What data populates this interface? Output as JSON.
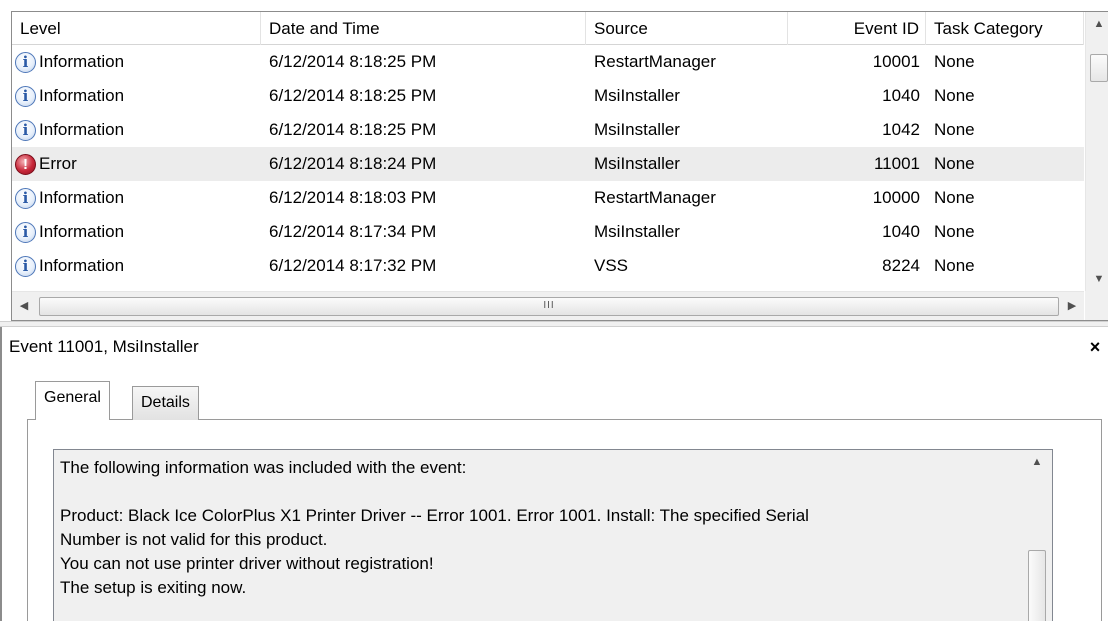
{
  "event_list": {
    "columns": {
      "level": "Level",
      "date_time": "Date and Time",
      "source": "Source",
      "event_id": "Event ID",
      "task_category": "Task Category"
    },
    "rows": [
      {
        "level": "Information",
        "level_icon": "information-icon",
        "date_time": "6/12/2014 8:18:25 PM",
        "source": "RestartManager",
        "event_id": "10001",
        "task_category": "None"
      },
      {
        "level": "Information",
        "level_icon": "information-icon",
        "date_time": "6/12/2014 8:18:25 PM",
        "source": "MsiInstaller",
        "event_id": "1040",
        "task_category": "None"
      },
      {
        "level": "Information",
        "level_icon": "information-icon",
        "date_time": "6/12/2014 8:18:25 PM",
        "source": "MsiInstaller",
        "event_id": "1042",
        "task_category": "None"
      },
      {
        "level": "Error",
        "level_icon": "error-icon",
        "date_time": "6/12/2014 8:18:24 PM",
        "source": "MsiInstaller",
        "event_id": "11001",
        "task_category": "None",
        "selected": true
      },
      {
        "level": "Information",
        "level_icon": "information-icon",
        "date_time": "6/12/2014 8:18:03 PM",
        "source": "RestartManager",
        "event_id": "10000",
        "task_category": "None"
      },
      {
        "level": "Information",
        "level_icon": "information-icon",
        "date_time": "6/12/2014 8:17:34 PM",
        "source": "MsiInstaller",
        "event_id": "1040",
        "task_category": "None"
      },
      {
        "level": "Information",
        "level_icon": "information-icon",
        "date_time": "6/12/2014 8:17:32 PM",
        "source": "VSS",
        "event_id": "8224",
        "task_category": "None"
      }
    ],
    "selection_color": "#ececec"
  },
  "detail": {
    "title": "Event 11001, MsiInstaller",
    "close_label": "×",
    "tabs": [
      {
        "label": "General",
        "active": true
      },
      {
        "label": "Details",
        "active": false
      }
    ],
    "description": "The following information was included with the event:\n\nProduct: Black Ice ColorPlus X1 Printer Driver -- Error 1001. Error 1001. Install: The specified Serial\nNumber is not valid for this product.\nYou can not use printer driver without registration!\nThe setup is exiting now."
  },
  "colors": {
    "info_accent": "#2b5aa6",
    "error_accent": "#c8283a"
  }
}
